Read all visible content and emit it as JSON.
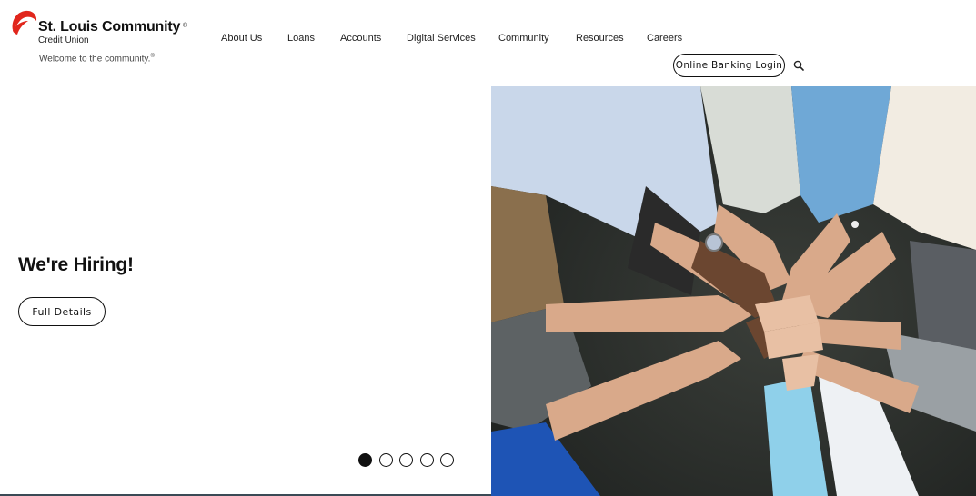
{
  "brand": {
    "name": "St. Louis Community",
    "registered_mark": "®",
    "subname": "Credit Union",
    "tagline": "Welcome to the community.",
    "tagline_mark": "®",
    "color": "#e1261c"
  },
  "nav": {
    "items": [
      {
        "label": "About Us"
      },
      {
        "label": "Loans"
      },
      {
        "label": "Accounts"
      },
      {
        "label": "Digital Services"
      },
      {
        "label": "Community"
      },
      {
        "label": "Resources"
      },
      {
        "label": "Careers"
      }
    ],
    "login_label": "Online Banking Login",
    "search_icon": "search-icon"
  },
  "hero": {
    "title": "We're Hiring!",
    "button_label": "Full Details",
    "slides_total": 5,
    "active_slide": 1,
    "image_subject": "hands stacked together"
  }
}
